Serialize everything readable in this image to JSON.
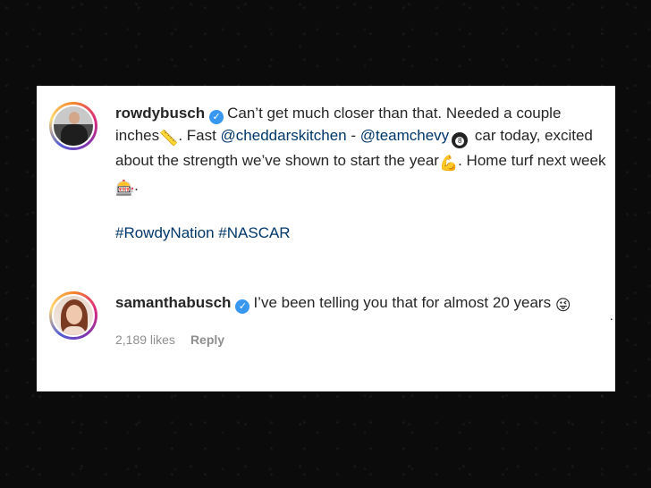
{
  "comments": [
    {
      "username": "rowdybusch",
      "text_1": "Can’t get much closer than that. Needed a couple inches",
      "emoji_ruler": "📏",
      "text_2": ". Fast ",
      "mention_1": "@cheddarskitchen",
      "text_3": " - ",
      "mention_2": "@teamchevy",
      "ball_number": "8",
      "text_4": " car today, excited about the strength we’ve shown to start the year",
      "emoji_muscle": "💪",
      "text_5": ". Home turf next week",
      "emoji_casino": "🎰",
      "text_6": ".",
      "hashtags": "#RowdyNation #NASCAR"
    },
    {
      "username": "samanthabusch",
      "text": "I’ve been telling you that for almost 20 years",
      "emoji": "😜",
      "likes": "2,189 likes",
      "reply_label": "Reply"
    }
  ],
  "verified_glyph": "✓"
}
